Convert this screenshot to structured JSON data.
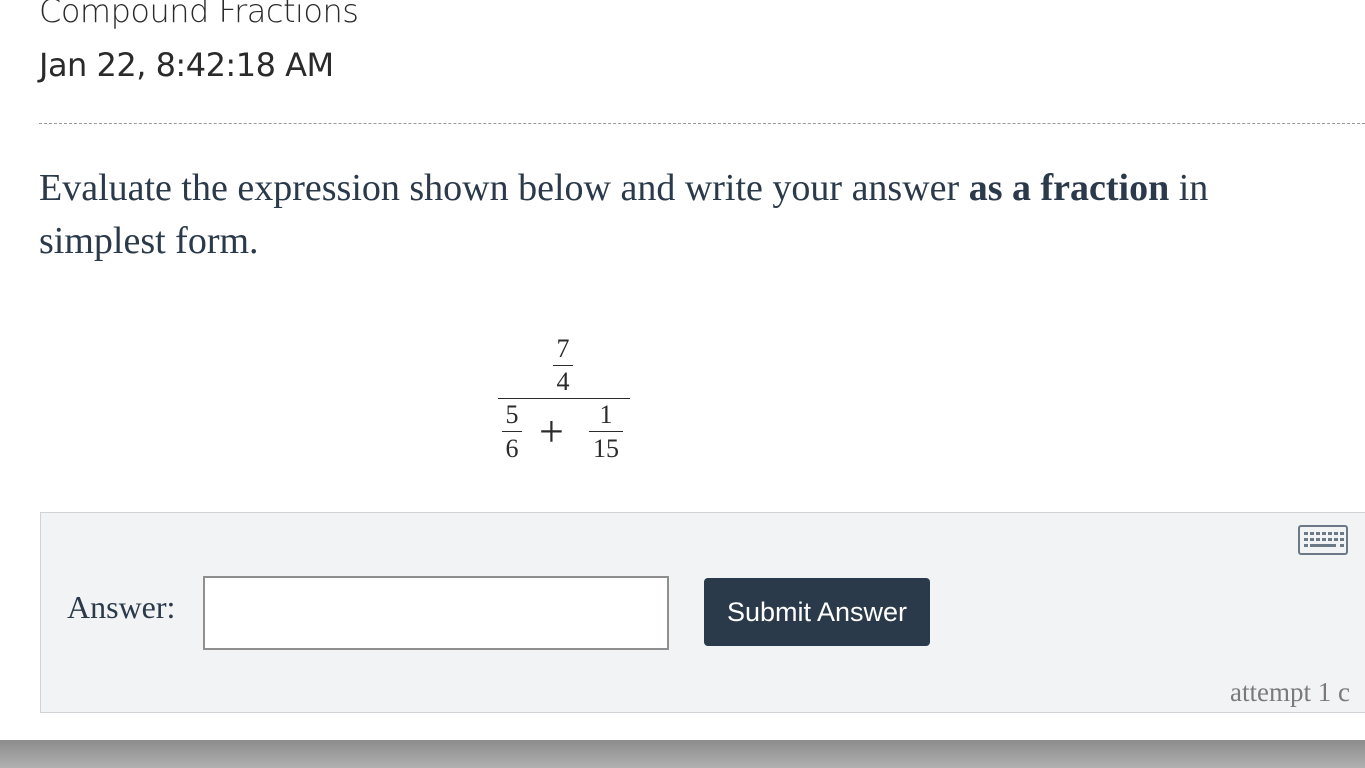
{
  "header": {
    "title": "Compound Fractions",
    "timestamp": "Jan 22, 8:42:18 AM"
  },
  "question": {
    "text_before": "Evaluate the expression shown below and write your answer ",
    "bold": "as a fraction",
    "text_after": " in simplest form."
  },
  "expression": {
    "top_numerator": "7",
    "top_denominator": "4",
    "left_numerator": "5",
    "left_denominator": "6",
    "operator": "+",
    "right_numerator": "1",
    "right_denominator": "15"
  },
  "answer": {
    "label": "Answer:",
    "value": "",
    "submit_label": "Submit Answer",
    "keyboard_icon": "keyboard-icon",
    "attempt_text": "attempt 1 c"
  }
}
